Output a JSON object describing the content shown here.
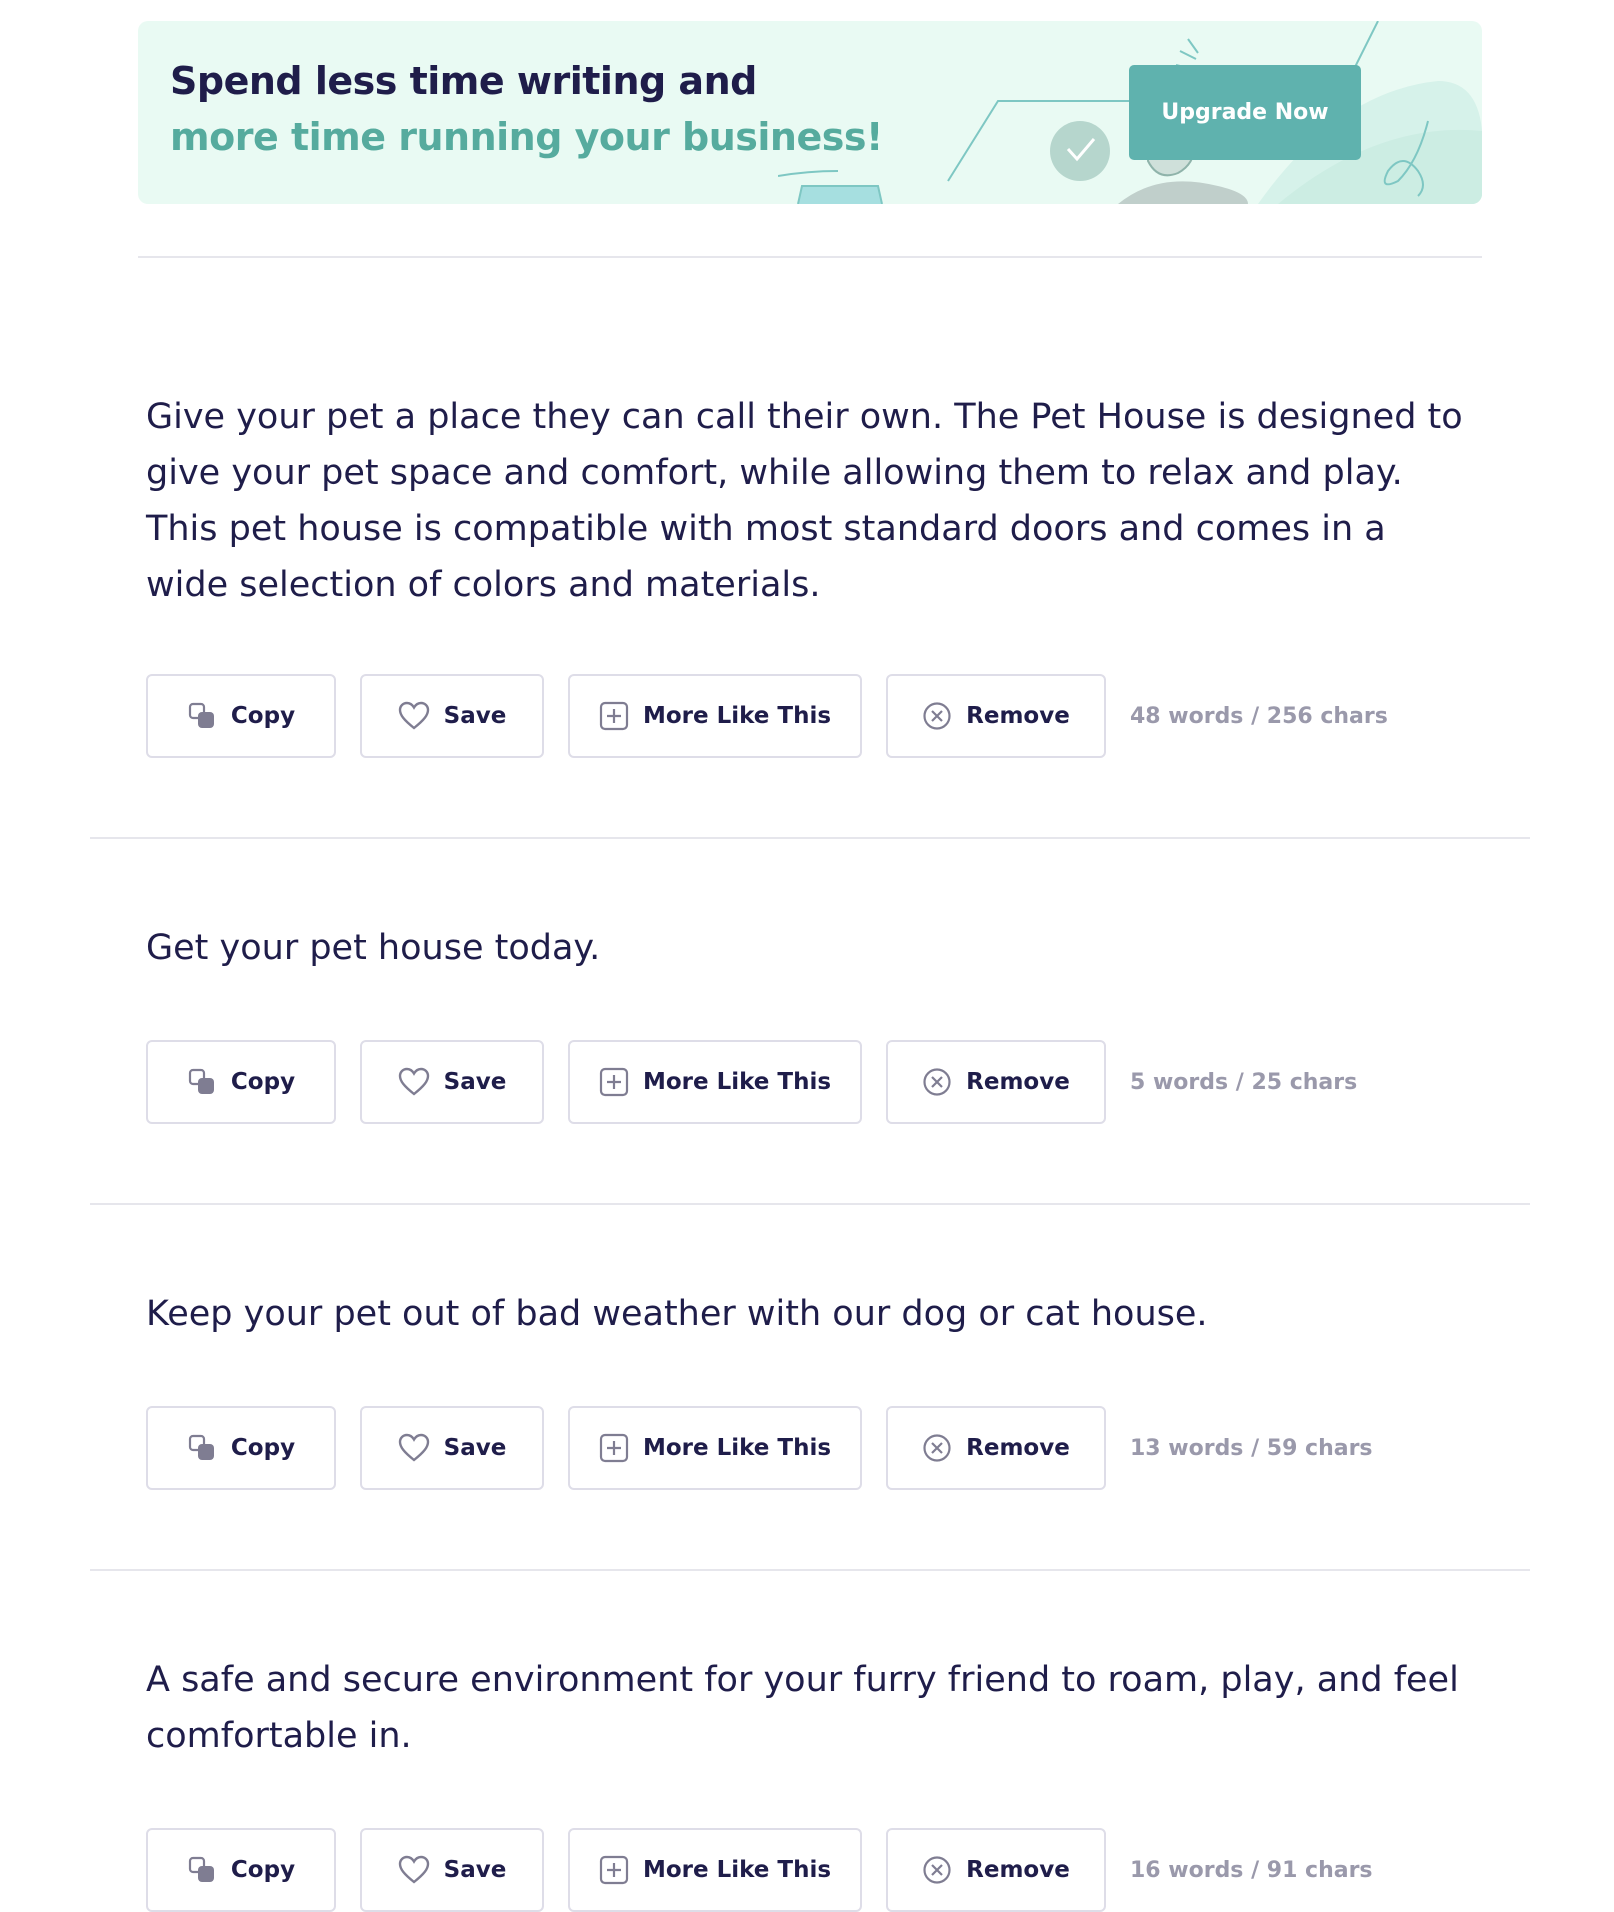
{
  "banner": {
    "line1": "Spend less time writing and",
    "line2": "more time running your business!",
    "upgrade_label": "Upgrade Now"
  },
  "actions": {
    "copy": "Copy",
    "save": "Save",
    "more": "More Like This",
    "remove": "Remove"
  },
  "results": [
    {
      "text": "Give your pet a place they can call their own. The Pet House is designed to give your pet space and comfort, while allowing them to relax and play. This pet house is compatible with most standard doors and comes in a wide selection of colors and materials.",
      "count": "48 words / 256 chars"
    },
    {
      "text": "Get your pet house today.",
      "count": "5 words / 25 chars"
    },
    {
      "text": "Keep your pet out of bad weather with our dog or cat house.",
      "count": "13 words / 59 chars"
    },
    {
      "text": "A safe and secure environment for your furry friend to roam, play, and feel comfortable in.",
      "count": "16 words / 91 chars"
    }
  ],
  "colors": {
    "text": "#1f1d4a",
    "accent": "#56ab9e",
    "button": "#5fb2ae",
    "banner_bg": "#e9faf3",
    "muted": "#9a99ab"
  }
}
